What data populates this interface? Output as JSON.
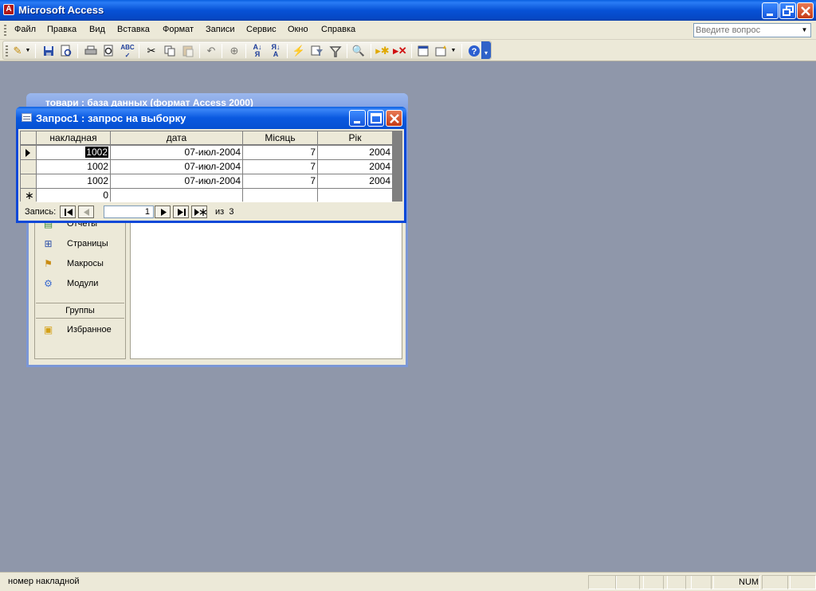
{
  "app": {
    "title": "Microsoft Access",
    "icon_letter": "A"
  },
  "menu": {
    "items": [
      "Файл",
      "Правка",
      "Вид",
      "Вставка",
      "Формат",
      "Записи",
      "Сервис",
      "Окно",
      "Справка"
    ],
    "ask_placeholder": "Введите вопрос"
  },
  "db_window": {
    "title": "товари : база данных (формат Access 2000)",
    "objects": [
      "Отчеты",
      "Страницы",
      "Макросы",
      "Модули"
    ],
    "groups_header": "Группы",
    "groups": [
      "Избранное"
    ]
  },
  "query_window": {
    "title": "Запрос1 : запрос на выборку",
    "columns": [
      "накладная",
      "дата",
      "Місяць",
      "Рік"
    ],
    "rows": [
      {
        "nakladna": "1002",
        "data": "07-июл-2004",
        "misyac": "7",
        "rik": "2004"
      },
      {
        "nakladna": "1002",
        "data": "07-июл-2004",
        "misyac": "7",
        "rik": "2004"
      },
      {
        "nakladna": "1002",
        "data": "07-июл-2004",
        "misyac": "7",
        "rik": "2004"
      }
    ],
    "new_row": {
      "nakladna": "0"
    },
    "navigator": {
      "label": "Запись:",
      "current": "1",
      "of_label": "из",
      "total": "3"
    }
  },
  "status": {
    "message": "номер накладной",
    "num_indicator": "NUM"
  },
  "colors": {
    "desktop": "#8f97aa",
    "titlebar": "#0752d6",
    "chrome": "#ece9d8"
  }
}
